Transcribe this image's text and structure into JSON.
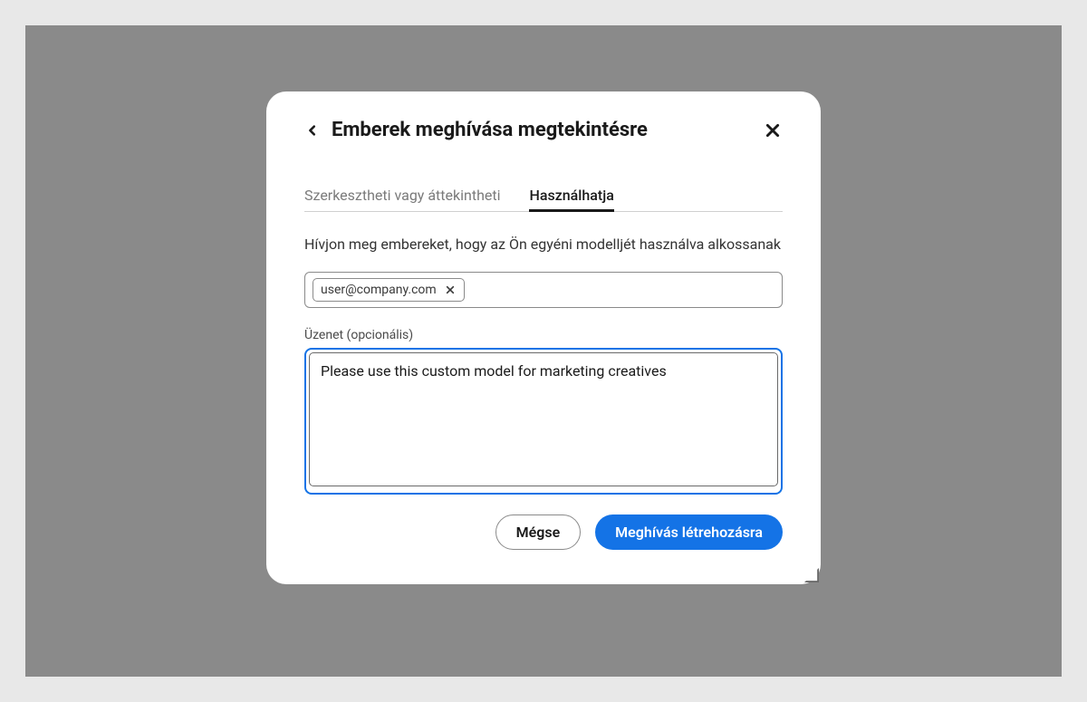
{
  "dialog": {
    "title": "Emberek meghívása megtekintésre"
  },
  "tabs": {
    "edit_view": "Szerkesztheti vagy áttekintheti",
    "use": "Használhatja"
  },
  "instruction": "Hívjon meg embereket, hogy az Ön egyéni modelljét használva alkossanak",
  "email": {
    "chip": "user@company.com"
  },
  "message": {
    "label": "Üzenet (opcionális)",
    "value": "Please use this custom model for marketing creatives"
  },
  "actions": {
    "cancel": "Mégse",
    "invite": "Meghívás létrehozásra"
  },
  "colors": {
    "accent": "#1473e6",
    "backdrop": "#8a8a8a",
    "page": "#e8e8e8"
  }
}
